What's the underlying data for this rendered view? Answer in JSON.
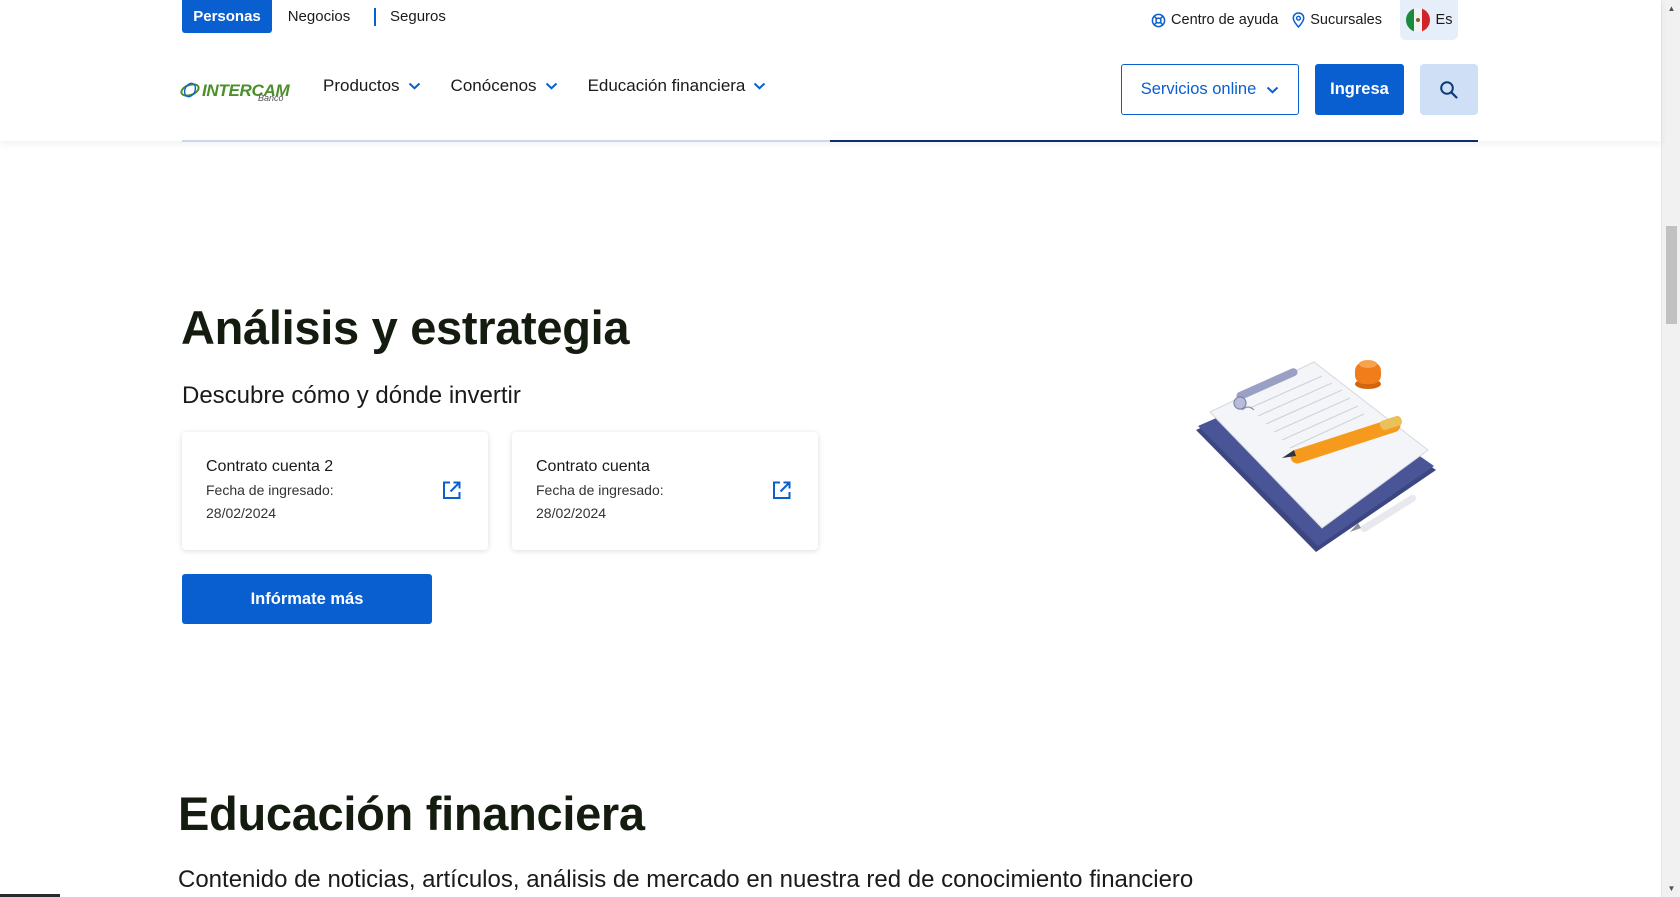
{
  "header": {
    "segments": [
      {
        "label": "Personas",
        "active": true
      },
      {
        "label": "Negocios",
        "active": false
      },
      {
        "label": "Seguros",
        "active": false
      }
    ],
    "utility": {
      "help_label": "Centro de ayuda",
      "branches_label": "Sucursales",
      "language_label": "Es"
    },
    "logo": {
      "word": "INTERCAM",
      "sub": "Banco"
    },
    "nav": [
      {
        "label": "Productos"
      },
      {
        "label": "Conócenos"
      },
      {
        "label": "Educación financiera"
      }
    ],
    "servicios_label": "Servicios online",
    "ingresa_label": "Ingresa",
    "scroll_progress": 0.5,
    "colors": {
      "primary": "#0a5fd0",
      "dark_navy": "#0b2e6b",
      "search_bg": "#cfe0f6",
      "logo_green": "#4a8f2a"
    }
  },
  "analysis": {
    "title": "Análisis y estrategia",
    "subtitle": "Descubre cómo y dónde invertir",
    "cards": [
      {
        "title": "Contrato cuenta 2",
        "date_label": "Fecha de ingresado:",
        "date": "28/02/2024",
        "icon": "external-link-icon"
      },
      {
        "title": "Contrato cuenta",
        "date_label": "Fecha de ingresado:",
        "date": "28/02/2024",
        "icon": "external-link-icon"
      }
    ],
    "cta_label": "Infórmate más"
  },
  "education": {
    "title": "Educación financiera",
    "subtitle": "Contenido de noticias, artículos, análisis de mercado en nuestra red de conocimiento financiero"
  }
}
